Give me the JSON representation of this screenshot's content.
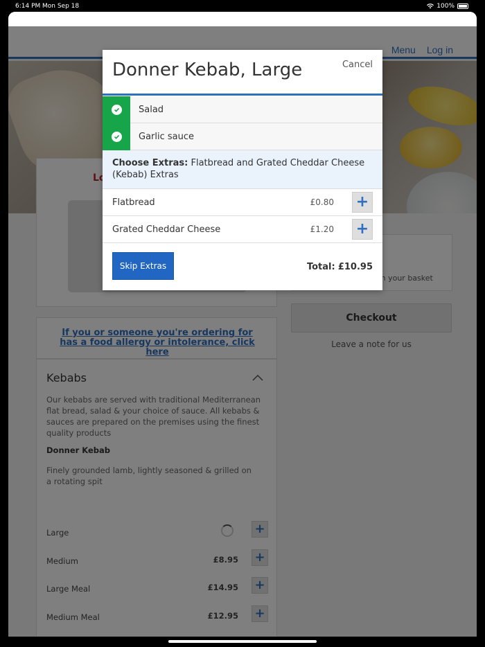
{
  "statusbar": {
    "time": "6:14 PM",
    "date": "Mon Sep 18",
    "battery": "100%"
  },
  "site": {
    "nav": {
      "menu": "Menu",
      "login": "Log in"
    },
    "promo_text": "Lo",
    "basket_msg": "There are no items in your basket",
    "checkout": "Checkout",
    "leave_note": "Leave a note for us",
    "allergy_link": "If you or someone you're ordering for has a food allergy or intolerance, click here"
  },
  "menu": {
    "section_title": "Kebabs",
    "section_desc": "Our kebabs are served with traditional Mediterranean flat bread, salad & your choice of sauce. All kebabs & sauces are prepared on the premises using the finest quality products",
    "item_name": "Donner Kebab",
    "item_desc": "Finely grounded lamb, lightly seasoned & grilled on a rotating spit",
    "options": [
      {
        "label": "Large",
        "price": ""
      },
      {
        "label": "Medium",
        "price": "£8.95"
      },
      {
        "label": "Large Meal",
        "price": "£14.95"
      },
      {
        "label": "Medium Meal",
        "price": "£12.95"
      }
    ],
    "add_symbol": "+"
  },
  "modal": {
    "title": "Donner Kebab, Large",
    "cancel": "Cancel",
    "choices": [
      {
        "label": "Salad"
      },
      {
        "label": "Garlic sauce"
      }
    ],
    "extras_heading_bold": "Choose Extras:",
    "extras_heading_rest": " Flatbread and Grated Cheddar Cheese (Kebab) Extras",
    "extras": [
      {
        "label": "Flatbread",
        "price": "£0.80"
      },
      {
        "label": "Grated Cheddar Cheese",
        "price": "£1.20"
      }
    ],
    "add_symbol": "+",
    "skip_button": "Skip Extras",
    "total_label": "Total:",
    "total_value": "£10.95"
  },
  "colors": {
    "accent": "#2e6fbf",
    "check_green": "#17a54a",
    "skip_button": "#2166c2",
    "promo_red": "#c0242b"
  }
}
